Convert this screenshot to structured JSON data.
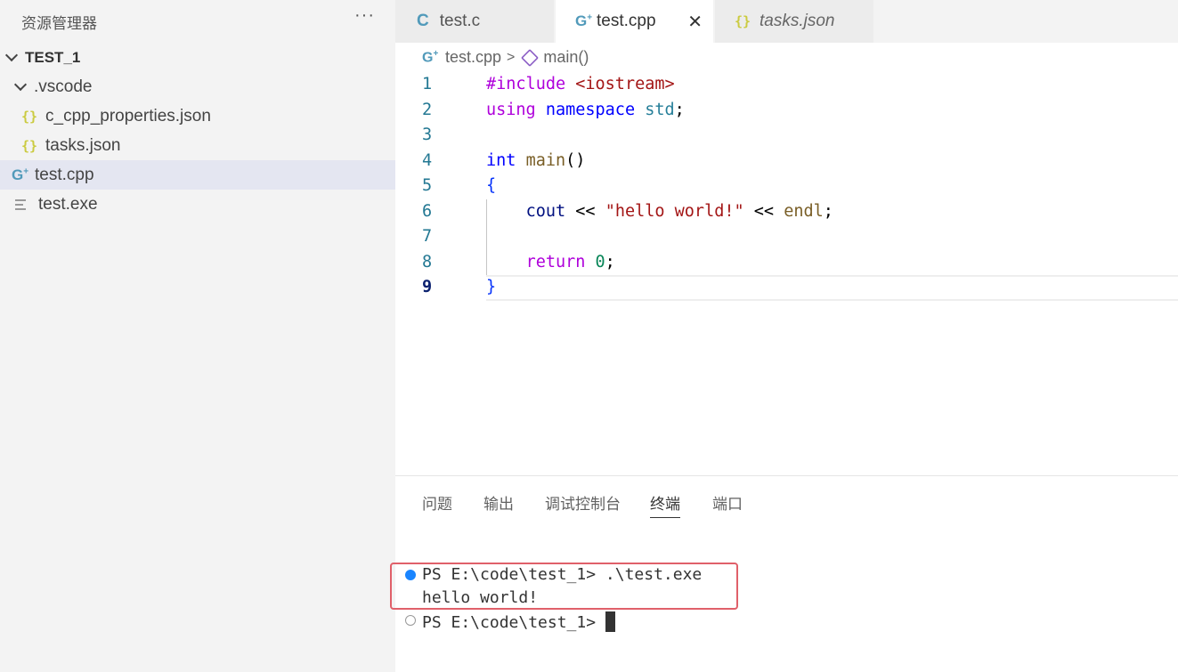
{
  "sidebar": {
    "title": "资源管理器",
    "more": "···",
    "root": "TEST_1",
    "folder": ".vscode",
    "files": {
      "c_cpp_properties": "c_cpp_properties.json",
      "tasks": "tasks.json",
      "testcpp": "test.cpp",
      "testexe": "test.exe"
    },
    "json_icon": "{}",
    "cpp_icon": "G"
  },
  "tabs": [
    {
      "label": "test.c",
      "icon": "C"
    },
    {
      "label": "test.cpp",
      "icon": "G"
    },
    {
      "label": "tasks.json",
      "icon": "{}"
    }
  ],
  "tab_close": "✕",
  "breadcrumb": {
    "file": "test.cpp",
    "symbol": "main()"
  },
  "editor": {
    "line_numbers": [
      "1",
      "2",
      "3",
      "4",
      "5",
      "6",
      "7",
      "8",
      "9"
    ],
    "code": {
      "l1a": "#include",
      "l1b": "<iostream>",
      "l2a": "using",
      "l2b": "namespace",
      "l2c": "std",
      "l2d": ";",
      "l4a": "int",
      "l4b": "main",
      "l4c": "()",
      "l5": "{",
      "l6a": "cout",
      "l6b": " << ",
      "l6c": "\"hello world!\"",
      "l6d": " << ",
      "l6e": "endl",
      "l6f": ";",
      "l8a": "return",
      "l8b": "0",
      "l8c": ";",
      "l9": "}"
    }
  },
  "panel": {
    "tabs": [
      "问题",
      "输出",
      "调试控制台",
      "终端",
      "端口"
    ],
    "active_tab": "终端"
  },
  "terminal": {
    "line1": "PS E:\\code\\test_1> .\\test.exe",
    "line2": "hello world!",
    "line3": "PS E:\\code\\test_1> "
  },
  "colors": {
    "accent": "#1a85ff",
    "highlight_border": "#e0606a"
  }
}
